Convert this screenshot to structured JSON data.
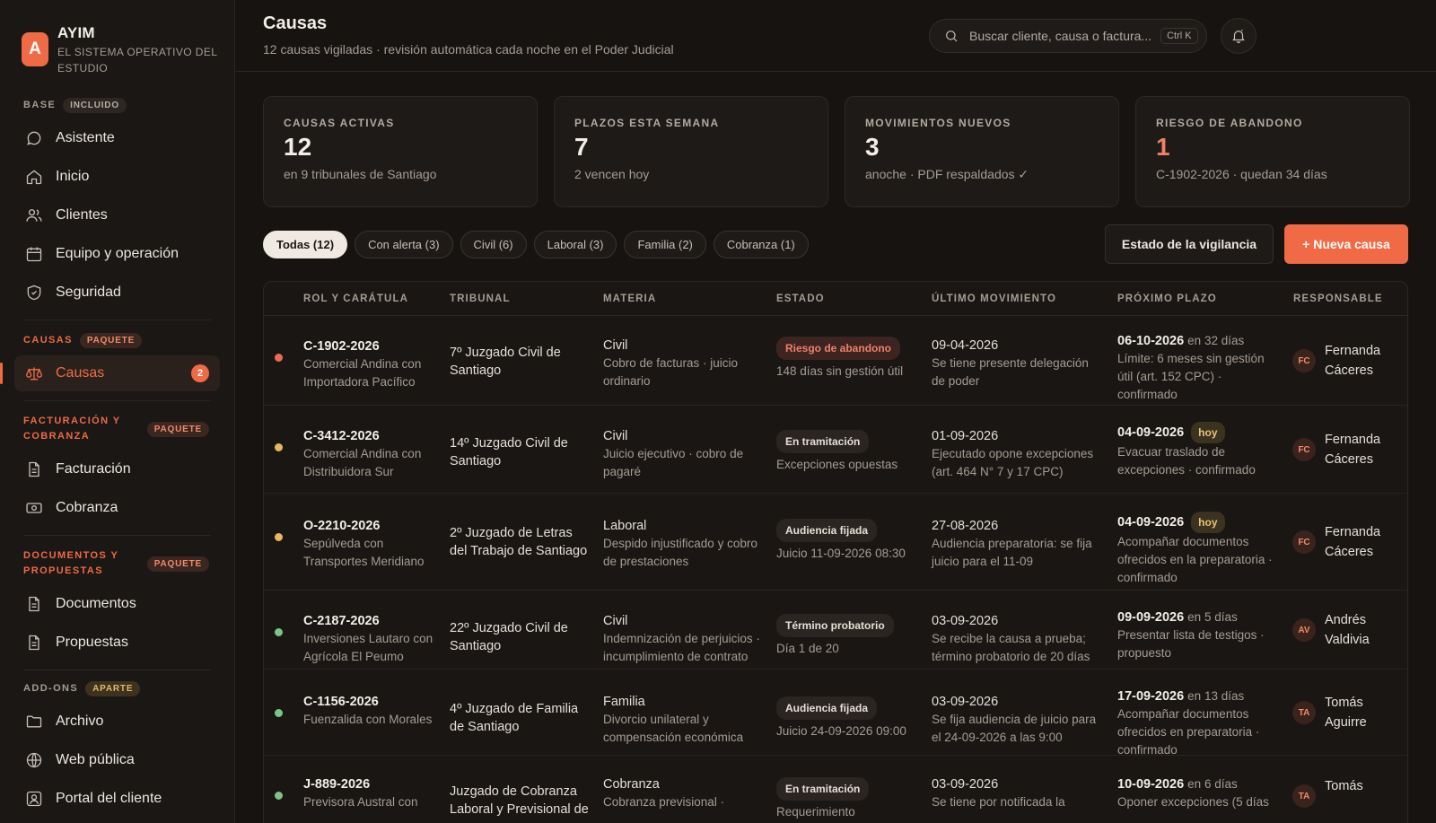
{
  "brand": {
    "logo_letter": "A",
    "name": "AYIM",
    "subtitle": "EL SISTEMA OPERATIVO DEL ESTUDIO"
  },
  "sidebar": {
    "sections": [
      {
        "label": "BASE",
        "pill": "INCLUIDO",
        "items": [
          {
            "label": "Asistente",
            "icon": "chat-icon"
          },
          {
            "label": "Inicio",
            "icon": "home-icon"
          },
          {
            "label": "Clientes",
            "icon": "users-icon"
          },
          {
            "label": "Equipo y operación",
            "icon": "calendar-icon"
          },
          {
            "label": "Seguridad",
            "icon": "shield-icon"
          }
        ]
      },
      {
        "label": "CAUSAS",
        "pill": "PAQUETE",
        "items": [
          {
            "label": "Causas",
            "icon": "scale-icon",
            "badge": "2",
            "active": true
          }
        ]
      },
      {
        "label": "FACTURACIÓN Y COBRANZA",
        "pill": "PAQUETE",
        "items": [
          {
            "label": "Facturación",
            "icon": "document-icon"
          },
          {
            "label": "Cobranza",
            "icon": "cash-icon"
          }
        ]
      },
      {
        "label": "DOCUMENTOS Y PROPUESTAS",
        "pill": "PAQUETE",
        "items": [
          {
            "label": "Documentos",
            "icon": "document-icon"
          },
          {
            "label": "Propuestas",
            "icon": "document-icon"
          }
        ]
      },
      {
        "label": "ADD-ONS",
        "pill": "APARTE",
        "items": [
          {
            "label": "Archivo",
            "icon": "folder-icon"
          },
          {
            "label": "Web pública",
            "icon": "globe-icon"
          },
          {
            "label": "Portal del cliente",
            "icon": "user-icon"
          }
        ]
      }
    ]
  },
  "header": {
    "title": "Causas",
    "subtitle": "12 causas vigiladas · revisión automática cada noche en el Poder Judicial",
    "search_placeholder": "Buscar cliente, causa o factura...",
    "search_shortcut": "Ctrl K"
  },
  "stats": [
    {
      "label": "CAUSAS ACTIVAS",
      "value": "12",
      "note": "en 9 tribunales de Santiago"
    },
    {
      "label": "PLAZOS ESTA SEMANA",
      "value": "7",
      "note": "2 vencen hoy"
    },
    {
      "label": "MOVIMIENTOS NUEVOS",
      "value": "3",
      "note": "anoche · PDF respaldados ✓"
    },
    {
      "label": "RIESGO DE ABANDONO",
      "value": "1",
      "note": "C-1902-2026 · quedan 34 días"
    }
  ],
  "filters": [
    "Todas (12)",
    "Con alerta (3)",
    "Civil (6)",
    "Laboral (3)",
    "Familia (2)",
    "Cobranza (1)"
  ],
  "actions": {
    "watch_status": "Estado de la vigilancia",
    "new_case": "+ Nueva causa"
  },
  "colors": {
    "accent": "#f06a45",
    "alert": "#f06a5a",
    "warning": "#e8b860",
    "ok": "#7cc48a"
  },
  "table": {
    "headers": [
      "ROL Y CARÁTULA",
      "TRIBUNAL",
      "MATERIA",
      "ESTADO",
      "ÚLTIMO MOVIMIENTO",
      "PRÓXIMO PLAZO",
      "RESPONSABLE"
    ],
    "rows": [
      {
        "status_color": "alert",
        "rol": "C-1902-2026",
        "caratula": "Comercial Andina con Importadora Pacífico",
        "tribunal": "7º Juzgado Civil de Santiago",
        "materia": "Civil",
        "materia_detalle": "Cobro de facturas · juicio ordinario",
        "estado": "Riesgo de abandono",
        "estado_risk": true,
        "estado_detalle": "148 días sin gestión útil",
        "mov_fecha": "09-04-2026",
        "mov_detalle": "Se tiene presente delegación de poder",
        "plazo_fecha": "06-10-2026",
        "plazo_en": "en 32 días",
        "plazo_hoy": "",
        "plazo_detalle": "Límite: 6 meses sin gestión útil (art. 152 CPC) · confirmado",
        "iniciales": "FC",
        "responsable": "Fernanda Cáceres"
      },
      {
        "status_color": "warning",
        "rol": "C-3412-2026",
        "caratula": "Comercial Andina con Distribuidora Sur",
        "tribunal": "14º Juzgado Civil de Santiago",
        "materia": "Civil",
        "materia_detalle": "Juicio ejecutivo · cobro de pagaré",
        "estado": "En tramitación",
        "estado_risk": false,
        "estado_detalle": "Excepciones opuestas",
        "mov_fecha": "01-09-2026",
        "mov_detalle": "Ejecutado opone excepciones (art. 464 N° 7 y 17 CPC)",
        "plazo_fecha": "04-09-2026",
        "plazo_en": "",
        "plazo_hoy": "hoy",
        "plazo_detalle": "Evacuar traslado de excepciones · confirmado",
        "iniciales": "FC",
        "responsable": "Fernanda Cáceres"
      },
      {
        "status_color": "warning",
        "rol": "O-2210-2026",
        "caratula": "Sepúlveda con Transportes Meridiano",
        "tribunal": "2º Juzgado de Letras del Trabajo de Santiago",
        "materia": "Laboral",
        "materia_detalle": "Despido injustificado y cobro de prestaciones",
        "estado": "Audiencia fijada",
        "estado_risk": false,
        "estado_detalle": "Juicio 11-09-2026 08:30",
        "mov_fecha": "27-08-2026",
        "mov_detalle": "Audiencia preparatoria: se fija juicio para el 11-09",
        "plazo_fecha": "04-09-2026",
        "plazo_en": "",
        "plazo_hoy": "hoy",
        "plazo_detalle": "Acompañar documentos ofrecidos en la preparatoria · confirmado",
        "iniciales": "FC",
        "responsable": "Fernanda Cáceres"
      },
      {
        "status_color": "ok",
        "rol": "C-2187-2026",
        "caratula": "Inversiones Lautaro con Agrícola El Peumo",
        "tribunal": "22º Juzgado Civil de Santiago",
        "materia": "Civil",
        "materia_detalle": "Indemnización de perjuicios · incumplimiento de contrato",
        "estado": "Término probatorio",
        "estado_risk": false,
        "estado_detalle": "Día 1 de 20",
        "mov_fecha": "03-09-2026",
        "mov_detalle": "Se recibe la causa a prueba; término probatorio de 20 días",
        "plazo_fecha": "09-09-2026",
        "plazo_en": "en 5 días",
        "plazo_hoy": "",
        "plazo_detalle": "Presentar lista de testigos · propuesto",
        "iniciales": "AV",
        "responsable": "Andrés Valdivia"
      },
      {
        "status_color": "ok",
        "rol": "C-1156-2026",
        "caratula": "Fuenzalida con Morales",
        "tribunal": "4º Juzgado de Familia de Santiago",
        "materia": "Familia",
        "materia_detalle": "Divorcio unilateral y compensación económica",
        "estado": "Audiencia fijada",
        "estado_risk": false,
        "estado_detalle": "Juicio 24-09-2026 09:00",
        "mov_fecha": "03-09-2026",
        "mov_detalle": "Se fija audiencia de juicio para el 24-09-2026 a las 9:00",
        "plazo_fecha": "17-09-2026",
        "plazo_en": "en 13 días",
        "plazo_hoy": "",
        "plazo_detalle": "Acompañar documentos ofrecidos en preparatoria · confirmado",
        "iniciales": "TA",
        "responsable": "Tomás Aguirre"
      },
      {
        "status_color": "ok",
        "rol": "J-889-2026",
        "caratula": "Previsora Austral con",
        "tribunal": "Juzgado de Cobranza Laboral y Previsional de",
        "materia": "Cobranza",
        "materia_detalle": "Cobranza previsional ·",
        "estado": "En tramitación",
        "estado_risk": false,
        "estado_detalle": "Requerimiento",
        "mov_fecha": "03-09-2026",
        "mov_detalle": "Se tiene por notificada la",
        "plazo_fecha": "10-09-2026",
        "plazo_en": "en 6 días",
        "plazo_hoy": "",
        "plazo_detalle": "Oponer excepciones (5 días",
        "iniciales": "TA",
        "responsable": "Tomás"
      }
    ]
  }
}
